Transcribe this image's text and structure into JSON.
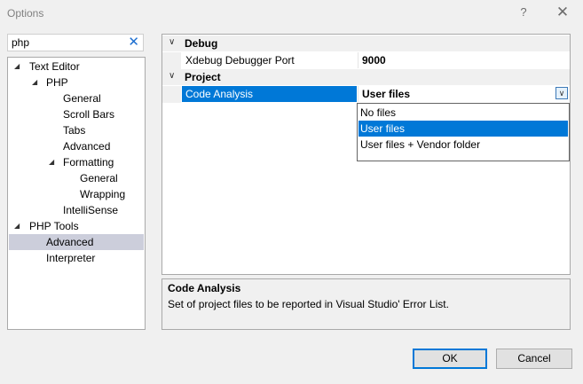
{
  "window": {
    "title": "Options",
    "help_glyph": "?",
    "close_glyph": "✕"
  },
  "search": {
    "value": "php",
    "clear_glyph": "✕"
  },
  "tree": {
    "expanded_glyph": "◢",
    "items": [
      {
        "label": "Text Editor",
        "expanded": true
      },
      {
        "label": "PHP",
        "expanded": true
      },
      {
        "label": "General"
      },
      {
        "label": "Scroll Bars"
      },
      {
        "label": "Tabs"
      },
      {
        "label": "Advanced"
      },
      {
        "label": "Formatting",
        "expanded": true
      },
      {
        "label": "General"
      },
      {
        "label": "Wrapping"
      },
      {
        "label": "IntelliSense"
      },
      {
        "label": "PHP Tools",
        "expanded": true
      },
      {
        "label": "Advanced",
        "selected": true
      },
      {
        "label": "Interpreter"
      }
    ]
  },
  "grid": {
    "collapse_glyph": "∨",
    "categories": [
      {
        "label": "Debug"
      },
      {
        "label": "Project"
      }
    ],
    "properties": [
      {
        "name": "Xdebug Debugger Port",
        "value": "9000"
      },
      {
        "name": "Code Analysis",
        "value": "User files",
        "selected": true
      }
    ],
    "dropdown_glyph": "∨"
  },
  "dropdown": {
    "options": [
      {
        "label": "No files"
      },
      {
        "label": "User files",
        "selected": true
      },
      {
        "label": "User files + Vendor folder"
      }
    ]
  },
  "description": {
    "title": "Code Analysis",
    "text": "Set of project files to be reported in Visual Studio' Error List."
  },
  "buttons": {
    "ok": "OK",
    "cancel": "Cancel"
  },
  "colors": {
    "accent": "#0078d7",
    "tree_selection": "#cccedb"
  }
}
